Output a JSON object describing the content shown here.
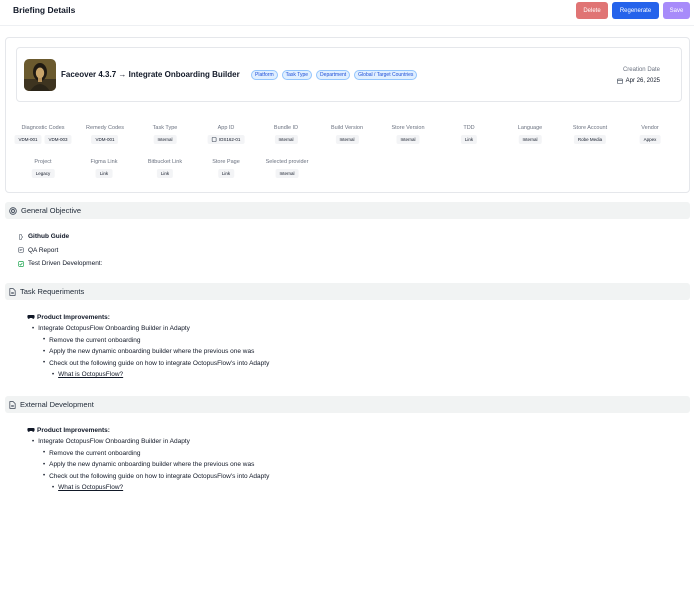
{
  "header": {
    "title": "Briefing Details",
    "delete_label": "Delete",
    "regenerate_label": "Regenerate",
    "save_label": "Save"
  },
  "briefing": {
    "app_title": "Faceover 4.3.7 → Integrate Onboarding Builder",
    "tags": [
      "Platform",
      "Task Type",
      "Department",
      "Global / Target Countries"
    ],
    "creation_date_label": "Creation Date",
    "creation_date": "Apr 26, 2025",
    "fields_row1": [
      {
        "label": "Diagnostic Codes",
        "values": [
          "VDM-001",
          "VDM-003"
        ]
      },
      {
        "label": "Remedy Codes",
        "values": [
          "VDM-001"
        ]
      },
      {
        "label": "Task Type",
        "values": [
          "Internal"
        ]
      },
      {
        "label": "App ID",
        "values": [
          "IOS162-01"
        ]
      },
      {
        "label": "Bundle ID",
        "values": [
          "Internal"
        ]
      },
      {
        "label": "Build Version",
        "values": [
          "Internal"
        ]
      },
      {
        "label": "Store Version",
        "values": [
          "Internal"
        ]
      },
      {
        "label": "TDD",
        "values": [
          "Link"
        ]
      },
      {
        "label": "Language",
        "values": [
          "Internal"
        ]
      },
      {
        "label": "Store Account",
        "values": [
          "Robe Media"
        ]
      },
      {
        "label": "Vendor",
        "values": [
          "Appex"
        ]
      }
    ],
    "fields_row2": [
      {
        "label": "Project",
        "values": [
          "Legacy"
        ]
      },
      {
        "label": "Figma Link",
        "values": [
          "Link"
        ]
      },
      {
        "label": "Bitbucket Link",
        "values": [
          "Link"
        ]
      },
      {
        "label": "Store Page",
        "values": [
          "Link"
        ]
      },
      {
        "label": "Selected provider",
        "values": [
          "Internal"
        ]
      }
    ]
  },
  "general_objective": {
    "title": "General Objective",
    "items": [
      "Github Guide",
      "QA Report",
      "Test Driven Development:"
    ]
  },
  "task_requirements": {
    "title": "Task Requeriments",
    "heading": "Product Improvements:",
    "item1": "Integrate OctopusFlow Onboarding Builder in Adapty",
    "sub1": "Remove the current onboarding",
    "sub2": "Apply the new dynamic onboarding builder where the previous one was",
    "sub3": "Check out the following guide on how to integrate OctopusFlow's into Adapty",
    "link": "What is OctopusFlow?"
  },
  "external_development": {
    "title": "External Development",
    "heading": "Product Improvements:",
    "item1": "Integrate OctopusFlow Onboarding Builder in Adapty",
    "sub1": "Remove the current onboarding",
    "sub2": "Apply the new dynamic onboarding builder where the previous one was",
    "sub3": "Check out the following guide on how to integrate OctopusFlow's into Adapty",
    "link": "What is OctopusFlow?"
  }
}
